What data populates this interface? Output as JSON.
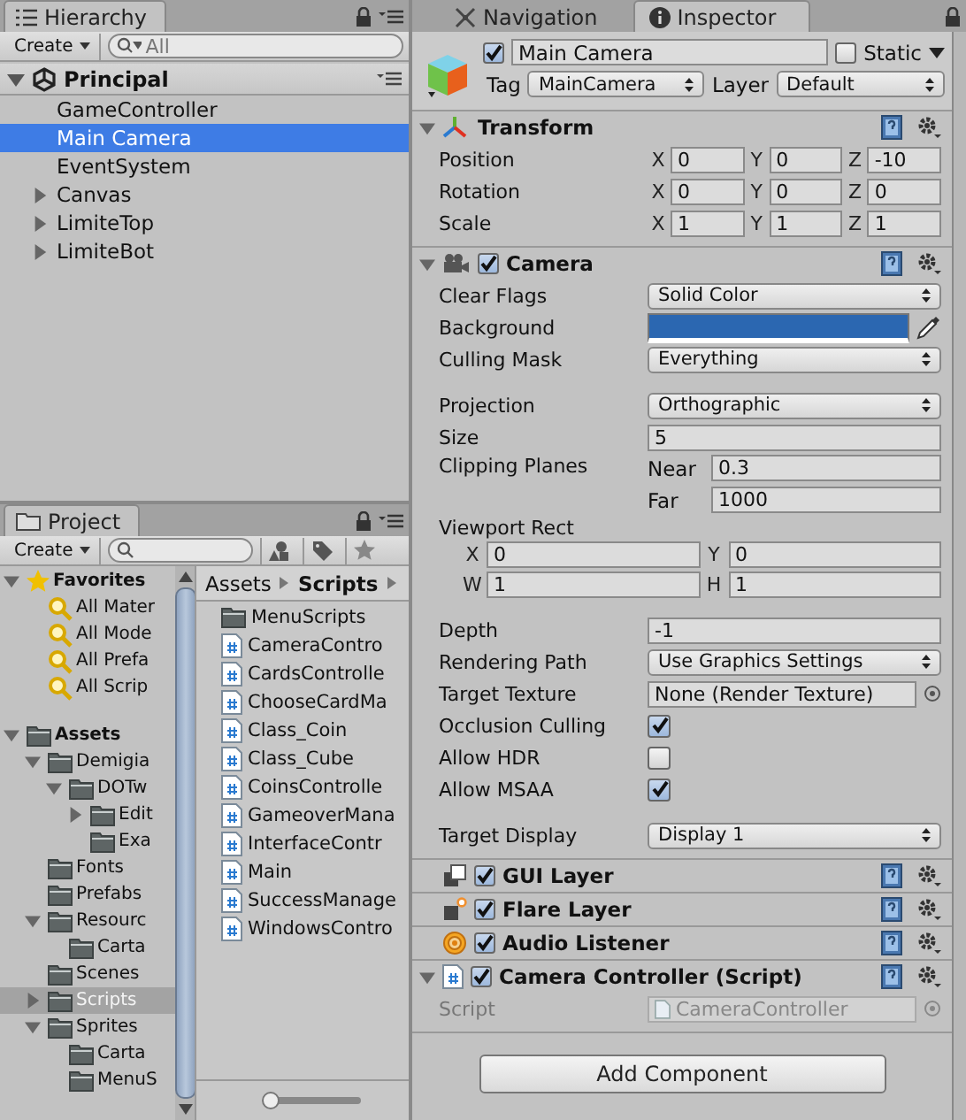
{
  "hierarchy": {
    "tab": "Hierarchy",
    "create": "Create",
    "search_placeholder": "All",
    "scenes": [
      {
        "name": "Principal",
        "expanded": true,
        "children": [
          {
            "name": "GameController",
            "selected": false
          },
          {
            "name": "Main Camera",
            "selected": true
          },
          {
            "name": "EventSystem",
            "selected": false
          },
          {
            "name": "Canvas",
            "selected": false,
            "expanded": false
          },
          {
            "name": "LimiteTop",
            "selected": false,
            "expanded": false
          },
          {
            "name": "LimiteBot",
            "selected": false,
            "expanded": false
          }
        ]
      }
    ]
  },
  "project": {
    "tab": "Project",
    "create": "Create",
    "tree": [
      {
        "name": "Favorites",
        "kind": "favorites",
        "selected": false,
        "expanded": true,
        "children": [
          {
            "name": "All Mater",
            "kind": "search",
            "selected": false
          },
          {
            "name": "All Mode",
            "kind": "search",
            "selected": false
          },
          {
            "name": "All Prefa",
            "kind": "search",
            "selected": false
          },
          {
            "name": "All Scrip",
            "kind": "search",
            "selected": false
          }
        ]
      },
      {
        "name": "Assets",
        "kind": "root",
        "selected": false,
        "expanded": true,
        "children": [
          {
            "name": "Demigia",
            "kind": "folder",
            "selected": false,
            "expanded": true,
            "children": [
              {
                "name": "DOTw",
                "kind": "folder",
                "selected": false,
                "expanded": true,
                "children": [
                  {
                    "name": "Edit",
                    "kind": "folder",
                    "selected": false,
                    "expanded": false
                  },
                  {
                    "name": "Exa",
                    "kind": "folder",
                    "selected": false
                  }
                ]
              }
            ]
          },
          {
            "name": "Fonts",
            "kind": "folder",
            "selected": false
          },
          {
            "name": "Prefabs",
            "kind": "folder",
            "selected": false
          },
          {
            "name": "Resourc",
            "kind": "folder",
            "selected": false,
            "expanded": true,
            "children": [
              {
                "name": "Carta",
                "kind": "folder",
                "selected": false
              }
            ]
          },
          {
            "name": "Scenes",
            "kind": "folder",
            "selected": false
          },
          {
            "name": "Scripts",
            "kind": "folder",
            "selected": true,
            "expanded": false
          },
          {
            "name": "Sprites",
            "kind": "folder",
            "selected": false,
            "expanded": true,
            "children": [
              {
                "name": "Carta",
                "kind": "folder",
                "selected": false
              },
              {
                "name": "MenuS",
                "kind": "folder",
                "selected": false
              }
            ]
          }
        ]
      }
    ],
    "breadcrumb": [
      "Assets",
      "Scripts"
    ],
    "files": [
      {
        "name": "MenuScripts",
        "kind": "folder"
      },
      {
        "name": "CameraContro",
        "kind": "script"
      },
      {
        "name": "CardsControlle",
        "kind": "script"
      },
      {
        "name": "ChooseCardMa",
        "kind": "script"
      },
      {
        "name": "Class_Coin",
        "kind": "script"
      },
      {
        "name": "Class_Cube",
        "kind": "script"
      },
      {
        "name": "CoinsControlle",
        "kind": "script"
      },
      {
        "name": "GameoverMana",
        "kind": "script"
      },
      {
        "name": "InterfaceContr",
        "kind": "script"
      },
      {
        "name": "Main",
        "kind": "script"
      },
      {
        "name": "SuccessManage",
        "kind": "script"
      },
      {
        "name": "WindowsContro",
        "kind": "script"
      }
    ],
    "zoom_slider": {
      "level": 0
    }
  },
  "inspector": {
    "tabs": [
      {
        "label": "Navigation",
        "selected": false
      },
      {
        "label": "Inspector",
        "selected": true
      }
    ],
    "object": {
      "active": true,
      "name": "Main Camera",
      "static": false,
      "static_label": "Static",
      "tag_label": "Tag",
      "tag": "MainCamera",
      "layer_label": "Layer",
      "layer": "Default"
    },
    "components": [
      {
        "kind": "transform",
        "title": "Transform",
        "expanded": true,
        "rows": [
          {
            "label": "Position",
            "fields": [
              {
                "axis": "X",
                "value": "0"
              },
              {
                "axis": "Y",
                "value": "0"
              },
              {
                "axis": "Z",
                "value": "-10"
              }
            ]
          },
          {
            "label": "Rotation",
            "fields": [
              {
                "axis": "X",
                "value": "0"
              },
              {
                "axis": "Y",
                "value": "0"
              },
              {
                "axis": "Z",
                "value": "0"
              }
            ]
          },
          {
            "label": "Scale",
            "fields": [
              {
                "axis": "X",
                "value": "1"
              },
              {
                "axis": "Y",
                "value": "1"
              },
              {
                "axis": "Z",
                "value": "1"
              }
            ]
          }
        ]
      },
      {
        "kind": "camera",
        "title": "Camera",
        "enabled": true,
        "expanded": true,
        "groups": [
          [
            {
              "kind": "dropdown",
              "label": "Clear Flags",
              "value": "Solid Color"
            },
            {
              "kind": "color",
              "label": "Background",
              "color": "#2b67b1"
            },
            {
              "kind": "dropdown",
              "label": "Culling Mask",
              "value": "Everything"
            }
          ],
          [
            {
              "kind": "dropdown",
              "label": "Projection",
              "value": "Orthographic"
            },
            {
              "kind": "field",
              "label": "Size",
              "value": "5"
            },
            {
              "kind": "pair",
              "label": "Clipping Planes",
              "fields": [
                {
                  "label": "Near",
                  "value": "0.3"
                },
                {
                  "label": "Far",
                  "value": "1000"
                }
              ]
            },
            {
              "kind": "rect",
              "label": "Viewport Rect",
              "fields": [
                {
                  "axis": "X",
                  "value": "0"
                },
                {
                  "axis": "Y",
                  "value": "0"
                },
                {
                  "axis": "W",
                  "value": "1"
                },
                {
                  "axis": "H",
                  "value": "1"
                }
              ]
            }
          ],
          [
            {
              "kind": "field",
              "label": "Depth",
              "value": "-1"
            },
            {
              "kind": "dropdown",
              "label": "Rendering Path",
              "value": "Use Graphics Settings"
            },
            {
              "kind": "object",
              "label": "Target Texture",
              "value": "None (Render Texture)"
            },
            {
              "kind": "checkbox",
              "label": "Occlusion Culling",
              "checked": true
            },
            {
              "kind": "checkbox",
              "label": "Allow HDR",
              "checked": false
            },
            {
              "kind": "checkbox",
              "label": "Allow MSAA",
              "checked": true
            }
          ],
          [
            {
              "kind": "dropdown",
              "label": "Target Display",
              "value": "Display 1"
            }
          ]
        ]
      },
      {
        "kind": "gui_layer",
        "title": "GUI Layer",
        "enabled": true
      },
      {
        "kind": "flare_layer",
        "title": "Flare Layer",
        "enabled": true
      },
      {
        "kind": "audio_listener",
        "title": "Audio Listener",
        "enabled": true
      },
      {
        "kind": "script",
        "title": "Camera Controller (Script)",
        "enabled": true,
        "expanded": true,
        "rows": [
          {
            "label": "Script",
            "value": "CameraController"
          }
        ]
      }
    ],
    "add_component": "Add Component"
  }
}
